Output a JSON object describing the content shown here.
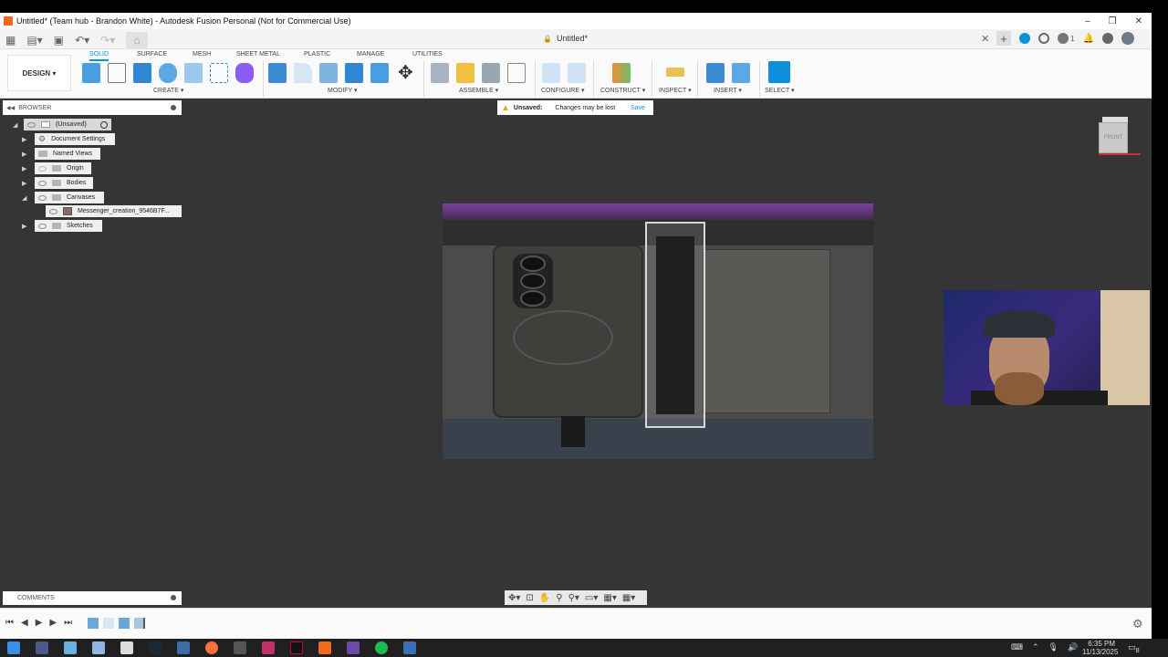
{
  "window": {
    "title": "Untitled* (Team hub - Brandon White) - Autodesk Fusion Personal (Not for Commercial Use)",
    "minimize": "–",
    "maximize": "❐",
    "close": "✕"
  },
  "quick_access": {
    "doc_title": "Untitled*",
    "lock_icon": "🔒",
    "jobs_count": "1"
  },
  "ribbon": {
    "design_label": "DESIGN ▾",
    "tabs": [
      "SOLID",
      "SURFACE",
      "MESH",
      "SHEET METAL",
      "PLASTIC",
      "MANAGE",
      "UTILITIES"
    ],
    "groups": [
      "CREATE ▾",
      "MODIFY ▾",
      "ASSEMBLE ▾",
      "CONFIGURE ▾",
      "CONSTRUCT ▾",
      "INSPECT ▾",
      "INSERT ▾",
      "SELECT ▾"
    ]
  },
  "browser": {
    "header": "BROWSER",
    "root": "(Unsaved)",
    "items": [
      "Document Settings",
      "Named Views",
      "Origin",
      "Bodies",
      "Canvases",
      "Messenger_creation_9546B7F...",
      "Sketches"
    ]
  },
  "banner": {
    "label": "Unsaved:",
    "message": "Changes may be lost",
    "action": "Save"
  },
  "viewcube": {
    "face": "FRONT"
  },
  "comments": {
    "label": "COMMENTS"
  },
  "taskbar": {
    "time": "6:35 PM",
    "date": "11/13/2025",
    "notif_count": "8"
  },
  "colors": {
    "accent": "#0696d7",
    "workspace": "#353535",
    "warning": "#e7a623"
  }
}
